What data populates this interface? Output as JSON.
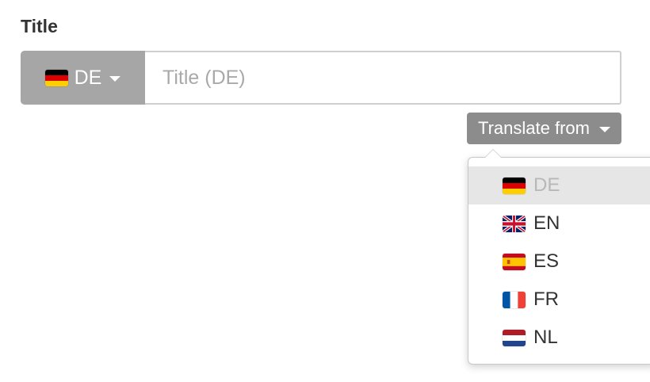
{
  "field": {
    "label": "Title",
    "input_placeholder": "Title (DE)",
    "input_value": ""
  },
  "language_button": {
    "label": "DE",
    "flag": "de-flag-icon"
  },
  "translate_button": {
    "label": "Translate from"
  },
  "dropdown": {
    "items": [
      {
        "label": "DE",
        "flag": "de-flag-icon",
        "disabled": true
      },
      {
        "label": "EN",
        "flag": "gb-flag-icon",
        "disabled": false
      },
      {
        "label": "ES",
        "flag": "es-flag-icon",
        "disabled": false
      },
      {
        "label": "FR",
        "flag": "fr-flag-icon",
        "disabled": false
      },
      {
        "label": "NL",
        "flag": "nl-flag-icon",
        "disabled": false
      }
    ]
  },
  "colors": {
    "language_button_bg": "#a6a6a6",
    "translate_button_bg": "#8c8c8c",
    "disabled_item_bg": "#e6e6e6"
  }
}
